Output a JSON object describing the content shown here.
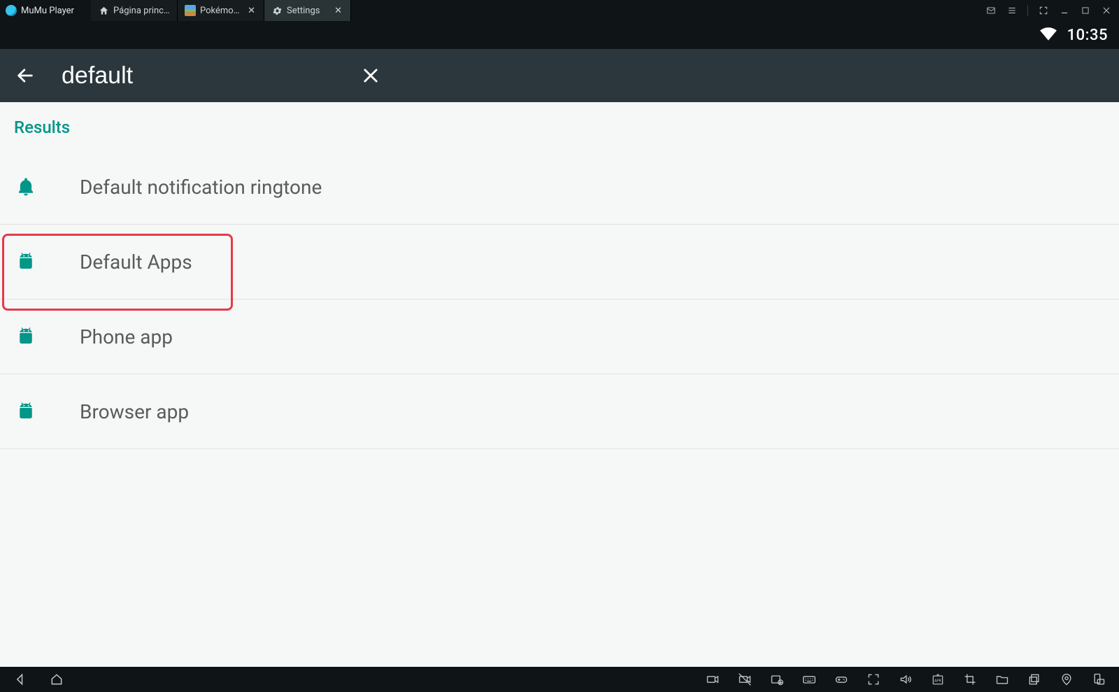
{
  "titlebar": {
    "app_name": "MuMu Player",
    "tabs": [
      {
        "label": "Página princi...",
        "closable": false,
        "icon": "home"
      },
      {
        "label": "Pokémon ...",
        "closable": true,
        "icon": "poke"
      },
      {
        "label": "Settings",
        "closable": true,
        "icon": "gear",
        "active": true
      }
    ]
  },
  "statusbar": {
    "time": "10:35"
  },
  "appbar": {
    "search_value": "default"
  },
  "results": {
    "header": "Results",
    "items": [
      {
        "icon": "bell",
        "label": "Default notification ringtone"
      },
      {
        "icon": "android",
        "label": "Default Apps",
        "highlighted": true
      },
      {
        "icon": "android",
        "label": "Phone app"
      },
      {
        "icon": "android",
        "label": "Browser app"
      }
    ]
  },
  "colors": {
    "teal": "#009688",
    "appbar_bg": "#2b373c",
    "dark": "#0f1416",
    "highlight": "#e53a49"
  }
}
